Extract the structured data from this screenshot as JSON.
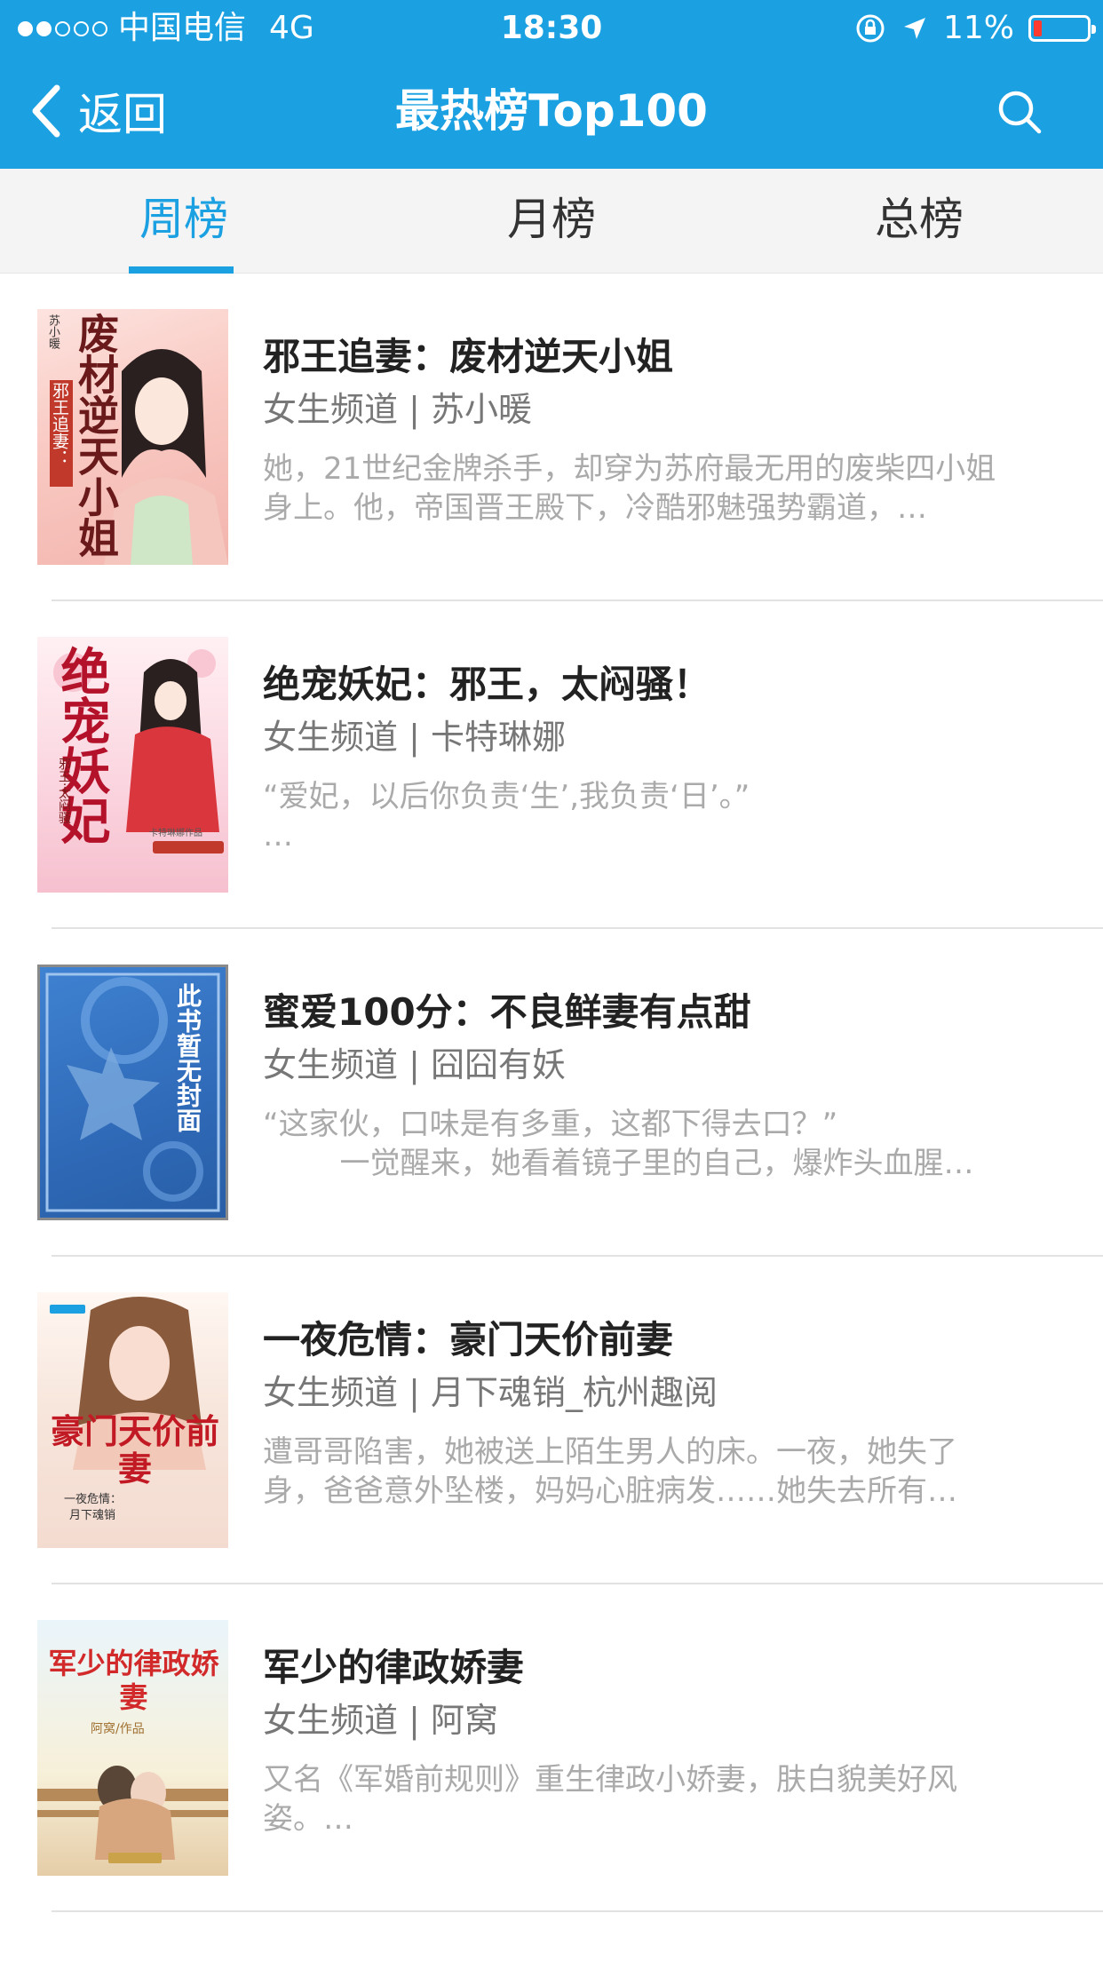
{
  "status": {
    "carrier": "中国电信",
    "network": "4G",
    "time": "18:30",
    "battery": "11%"
  },
  "nav": {
    "back_label": "返回",
    "title": "最热榜Top100",
    "search_icon": "search-icon"
  },
  "tabs": [
    {
      "label": "周榜",
      "active": true
    },
    {
      "label": "月榜",
      "active": false
    },
    {
      "label": "总榜",
      "active": false
    }
  ],
  "books": [
    {
      "title": "邪王追妻：废材逆天小姐",
      "meta": "女生频道 | 苏小暖",
      "desc": "她，21世纪金牌杀手，却穿为苏府最无用的废柴四小姐身上。他，帝国晋王殿下，冷酷邪魅强势霸道，…",
      "cover": {
        "title": "废材逆天小姐",
        "sub": "邪王追妻：",
        "author": "苏小暖"
      }
    },
    {
      "title": "绝宠妖妃：邪王，太闷骚！",
      "meta": "女生频道 | 卡特琳娜",
      "desc": "“爱妃，以后你负责‘生’,我负责‘日’。”\n…",
      "cover": {
        "title": "绝宠妖妃",
        "sub": "邪王·太闷骚",
        "author": "卡特琳娜作品"
      }
    },
    {
      "title": "蜜爱100分：不良鲜妻有点甜",
      "meta": "女生频道 | 囧囧有妖",
      "desc": "“这家伙，口味是有多重，这都下得去口？”\n        一觉醒来，她看着镜子里的自己，爆炸头血腥…",
      "cover": {
        "title": "此书暂无封面"
      }
    },
    {
      "title": "一夜危情：豪门天价前妻",
      "meta": "女生频道 | 月下魂销_杭州趣阅",
      "desc": "遭哥哥陷害，她被送上陌生男人的床。一夜，她失了身，爸爸意外坠楼，妈妈心脏病发……她失去所有…",
      "cover": {
        "title": "豪门天价前妻",
        "sub": "一夜危情：",
        "author": "月下魂销"
      }
    },
    {
      "title": "军少的律政娇妻",
      "meta": "女生频道 | 阿窝",
      "desc": "又名《军婚前规则》重生律政小娇妻，肤白貌美好风姿。…",
      "cover": {
        "title": "军少的律政娇妻",
        "author": "阿窝/作品"
      }
    }
  ],
  "colors": {
    "accent": "#1ba0e1",
    "title_text": "#222222",
    "meta_text": "#777777",
    "desc_text": "#aaaaaa"
  }
}
